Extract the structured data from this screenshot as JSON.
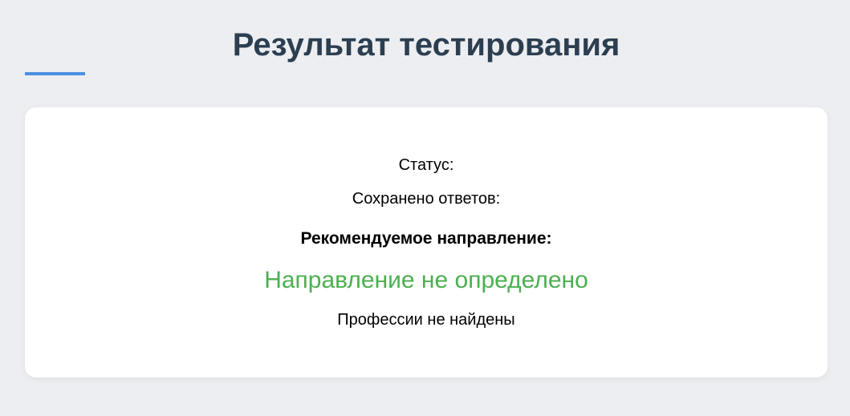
{
  "page": {
    "title": "Результат тестирования"
  },
  "result": {
    "status_label": "Статус:",
    "answers_label": "Сохранено ответов:",
    "recommended_heading": "Рекомендуемое направление:",
    "direction": "Направление не определено",
    "professions": "Профессии не найдены"
  },
  "colors": {
    "background": "#eceef1",
    "title": "#2c3e50",
    "accent": "#4a90e2",
    "direction": "#4caf50"
  }
}
